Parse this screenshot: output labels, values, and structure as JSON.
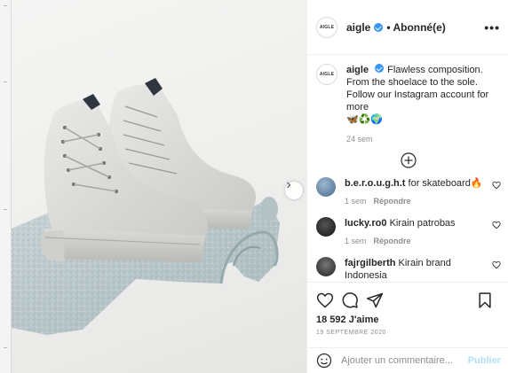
{
  "post": {
    "account": "aigle",
    "avatar_text": "AIGLE",
    "follow_status": "• Abonné(e)",
    "more_label": "•••"
  },
  "caption": {
    "username": "aigle",
    "text": "Flawless composition. From the shoelace to the sole.",
    "text2": "Follow our Instagram account for more",
    "emojis": "🦋♻️🌍",
    "time": "24 sem"
  },
  "comments": [
    {
      "username": "b.e.r.o.u.g.h.t",
      "text": "for skateboard🔥",
      "time": "1 sem",
      "reply": "Répondre",
      "avatar_color": "#5a7fa8"
    },
    {
      "username": "lucky.ro0",
      "text": "Kirain patrobas",
      "time": "1 sem",
      "reply": "Répondre",
      "avatar_color": "#1f1f1f"
    },
    {
      "username": "fajrgilberth",
      "text": "Kirain brand Indonesia",
      "time": "",
      "reply": "",
      "avatar_color": "#3b3b3b"
    }
  ],
  "stats": {
    "likes": "18 592 J'aime",
    "date": "19 SEPTEMBRE 2020"
  },
  "add_comment": {
    "placeholder": "Ajouter un commentaire...",
    "publish": "Publier"
  },
  "icons": {
    "like": "heart-icon",
    "comment": "comment-icon",
    "share": "paper-plane-icon",
    "save": "bookmark-icon",
    "emoji": "smiley-icon",
    "load_more": "plus-circle-icon",
    "next": "chevron-right-icon"
  },
  "colors": {
    "verified": "#3897f0",
    "publish_disabled": "#b2dffc",
    "muted": "#8e8e8e"
  }
}
